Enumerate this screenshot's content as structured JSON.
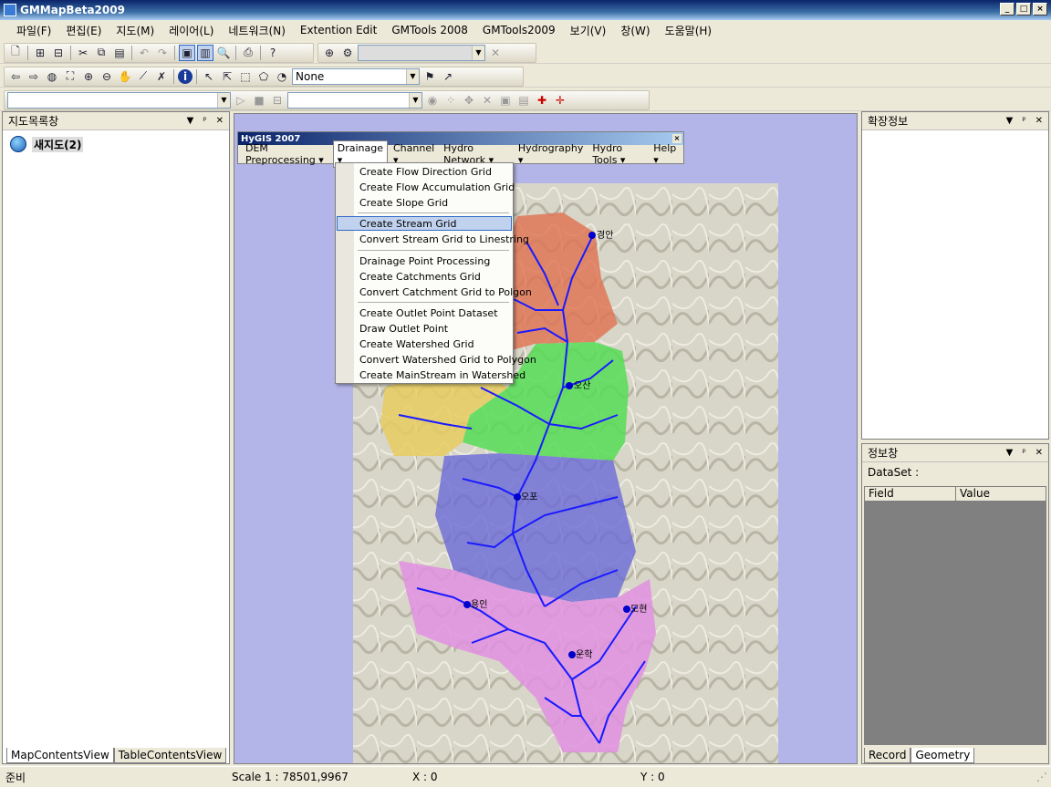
{
  "window": {
    "title": "GMMapBeta2009"
  },
  "menubar": [
    "파일(F)",
    "편집(E)",
    "지도(M)",
    "레이어(L)",
    "네트워크(N)",
    "Extention Edit",
    "GMTools 2008",
    "GMTools2009",
    "보기(V)",
    "창(W)",
    "도움말(H)"
  ],
  "toolbar2": {
    "combo_value": "None"
  },
  "left_panel": {
    "title": "지도목록창",
    "tree_root": "새지도(2)",
    "tabs": [
      "MapContentsView",
      "TableContentsView"
    ]
  },
  "right_top": {
    "title": "확장정보"
  },
  "right_bottom": {
    "title": "정보창",
    "dataset_label": "DataSet :",
    "columns": [
      "Field",
      "Value"
    ],
    "tabs": [
      "Record",
      "Geometry"
    ]
  },
  "hygis": {
    "title": "HyGIS 2007",
    "menu": [
      "DEM Preprocessing ▾",
      "Drainage ▾",
      "Channel ▾",
      "Hydro Network ▾",
      "Hydrography ▾",
      "Hydro Tools ▾",
      "Help ▾"
    ],
    "drainage_items": [
      "Create Flow Direction Grid",
      "Create Flow Accumulation Grid",
      "Create Slope Grid",
      "Create Stream Grid",
      "Convert Stream Grid to Linestring",
      "Drainage Point Processing",
      "Create Catchments Grid",
      "Convert Catchment Grid to Polgon",
      "Create Outlet Point Dataset",
      "Draw Outlet Point",
      "Create Watershed Grid",
      "Convert Watershed Grid to Polygon",
      "Create MainStream in Watershed"
    ],
    "highlighted": "Create Stream Grid"
  },
  "map_labels": [
    "경안",
    "오산",
    "오포",
    "용인",
    "모현",
    "운학"
  ],
  "statusbar": {
    "ready": "준비",
    "scale": "Scale 1 : 78501,9967",
    "x": "X : 0",
    "y": "Y : 0"
  },
  "colors": {
    "map_bg": "#b3b5e8",
    "stream": "#1a1aff",
    "selection": "#c1d2ee"
  }
}
